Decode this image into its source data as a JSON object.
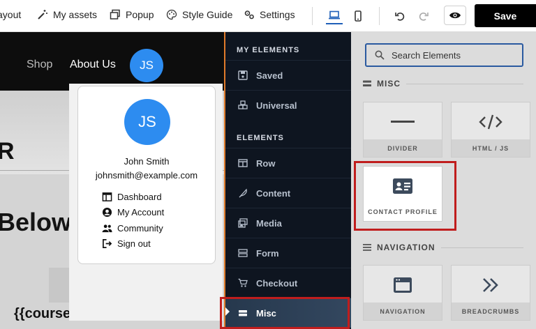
{
  "toolbar": {
    "layout_label": "ayout",
    "my_assets_label": "My assets",
    "popup_label": "Popup",
    "style_guide_label": "Style Guide",
    "settings_label": "Settings",
    "save_label": "Save"
  },
  "canvas": {
    "nav_links": [
      "Shop",
      "About Us"
    ],
    "nav_avatar_initials": "JS",
    "hero_letter": "R",
    "below_heading": "Below",
    "course_title": "{{course.title}}"
  },
  "profile_dropdown": {
    "avatar_initials": "JS",
    "name": "John Smith",
    "email": "johnsmith@example.com",
    "items": [
      "Dashboard",
      "My Account",
      "Community",
      "Sign out"
    ]
  },
  "elements_panel": {
    "my_elements_heading": "MY ELEMENTS",
    "my_elements": [
      "Saved",
      "Universal"
    ],
    "elements_heading": "ELEMENTS",
    "elements": [
      "Row",
      "Content",
      "Media",
      "Form",
      "Checkout",
      "Misc"
    ],
    "active_item": "Misc"
  },
  "library": {
    "search_placeholder": "Search Elements",
    "misc_heading": "MISC",
    "misc_tiles": [
      "DIVIDER",
      "HTML / JS",
      "CONTACT PROFILE"
    ],
    "navigation_heading": "NAVIGATION",
    "navigation_tiles": [
      "NAVIGATION",
      "BREADCRUMBS"
    ]
  },
  "colors": {
    "accent_blue": "#2d8cf0",
    "panel_bg": "#0e1520",
    "highlight_red": "#c01d1d",
    "canvas_border_orange": "#e07b2a"
  }
}
